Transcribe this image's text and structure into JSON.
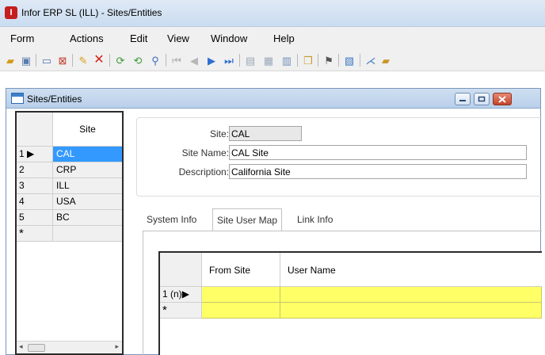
{
  "app": {
    "title": "Infor ERP SL (ILL) - Sites/Entities",
    "icon_letter": "I"
  },
  "menu": [
    "Form",
    "Actions",
    "Edit",
    "View",
    "Window",
    "Help"
  ],
  "toolbar_icons": [
    "open-folder-icon",
    "save-icon",
    "minimize-form-icon",
    "close-form-icon",
    "new-record-icon",
    "delete-icon",
    "refresh-icon",
    "refresh-all-icon",
    "filter-icon",
    "first-record-icon",
    "previous-record-icon",
    "next-record-icon",
    "last-record-icon",
    "print-icon",
    "print-preview-icon",
    "export-icon",
    "copy-record-icon",
    "find-icon",
    "notes-icon",
    "chart-icon",
    "form-icon"
  ],
  "child_window": {
    "title": "Sites/Entities"
  },
  "site_grid": {
    "column_header": "Site",
    "rows": [
      {
        "num": "1",
        "site": "CAL",
        "selected": true
      },
      {
        "num": "2",
        "site": "CRP",
        "selected": false
      },
      {
        "num": "3",
        "site": "ILL",
        "selected": false
      },
      {
        "num": "4",
        "site": "USA",
        "selected": false
      },
      {
        "num": "5",
        "site": "BC",
        "selected": false
      }
    ],
    "new_row_marker": "*"
  },
  "form": {
    "site_label": "Site:",
    "site_value": "CAL",
    "site_name_label": "Site Name:",
    "site_name_value": "CAL Site",
    "description_label": "Description:",
    "description_value": "California Site"
  },
  "tabs": [
    {
      "label": "System Info",
      "active": false
    },
    {
      "label": "Site User Map",
      "active": true
    },
    {
      "label": "Link Info",
      "active": false
    }
  ],
  "map_grid": {
    "columns": [
      "From Site",
      "User Name"
    ],
    "rows": [
      {
        "num": "1 (n)"
      }
    ],
    "new_row_marker": "*"
  },
  "colors": {
    "selected_row": "#3399ff",
    "required_cell": "#ffff66",
    "close_button": "#c4432a"
  }
}
